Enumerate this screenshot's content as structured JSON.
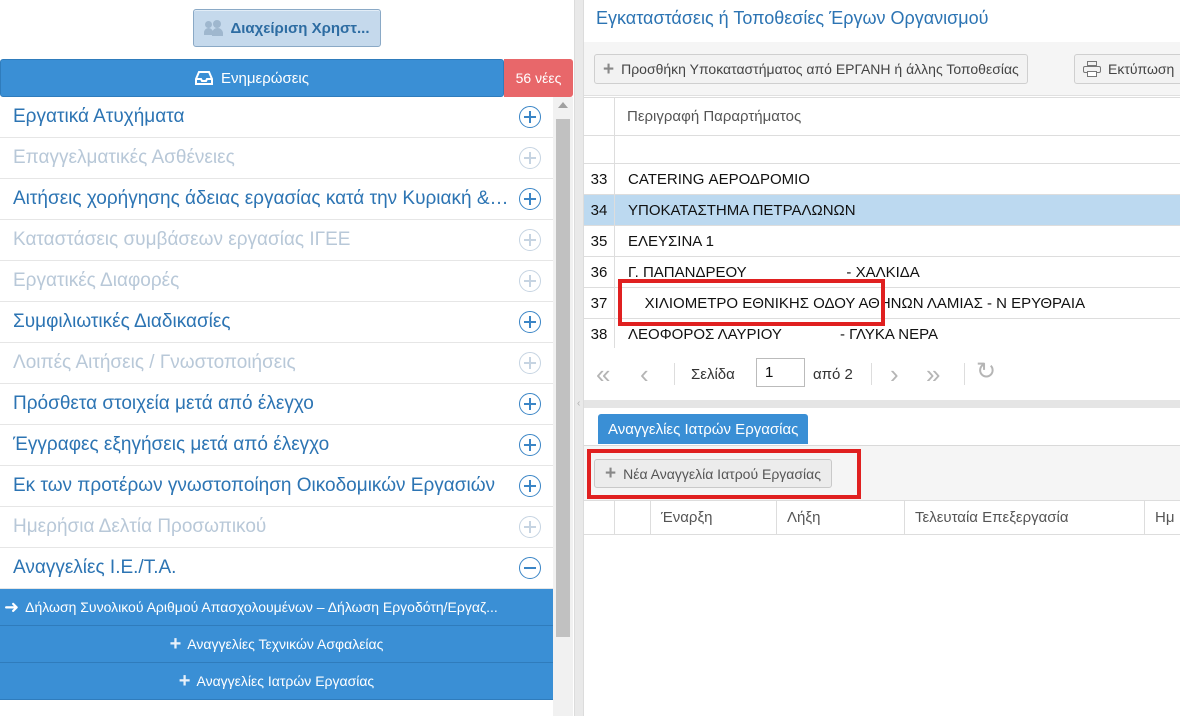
{
  "left": {
    "user_button": "Διαχείριση Χρηστ...",
    "updates_button": "Ενημερώσεις",
    "new_badge": "56 νέες",
    "menu": [
      {
        "label": "Εργατικά Ατυχήματα",
        "enabled": true,
        "state": "plus"
      },
      {
        "label": "Επαγγελματικές Ασθένειες",
        "enabled": false,
        "state": "plus"
      },
      {
        "label": "Αιτήσεις χορήγησης άδειας εργασίας κατά την Κυριακή & ...",
        "enabled": true,
        "state": "plus"
      },
      {
        "label": "Καταστάσεις συμβάσεων εργασίας ΙΓΕΕ",
        "enabled": false,
        "state": "plus"
      },
      {
        "label": "Εργατικές Διαφορές",
        "enabled": false,
        "state": "plus"
      },
      {
        "label": "Συμφιλιωτικές Διαδικασίες",
        "enabled": true,
        "state": "plus"
      },
      {
        "label": "Λοιπές Αιτήσεις / Γνωστοποιήσεις",
        "enabled": false,
        "state": "plus"
      },
      {
        "label": "Πρόσθετα στοιχεία μετά από έλεγχο",
        "enabled": true,
        "state": "plus"
      },
      {
        "label": "Έγγραφες εξηγήσεις μετά από έλεγχο",
        "enabled": true,
        "state": "plus"
      },
      {
        "label": "Εκ των προτέρων γνωστοποίηση Οικοδομικών Εργασιών",
        "enabled": true,
        "state": "plus"
      },
      {
        "label": "Ημερήσια Δελτία Προσωπικού",
        "enabled": false,
        "state": "plus"
      },
      {
        "label": "Αναγγελίες Ι.Ε./Τ.Α.",
        "enabled": true,
        "state": "minus"
      }
    ],
    "submenu": [
      "Δήλωση Συνολικού Αριθμού Απασχολουμένων – Δήλωση Εργοδότη/Εργαζ...",
      "Αναγγελίες Τεχνικών Ασφαλείας",
      "Αναγγελίες Ιατρών Εργασίας"
    ]
  },
  "right": {
    "title": "Εγκαταστάσεις ή Τοποθεσίες Έργων Οργανισμού",
    "add_branch_button": "Προσθήκη Υποκαταστήματος από ΕΡΓΑΝΗ ή άλλης Τοποθεσίας",
    "print_button": "Εκτύπωση",
    "grid_header": "Περιγραφή Παραρτήματος",
    "rows": [
      {
        "n": "33",
        "desc": "CATERING ΑΕΡΟΔΡΟΜΙΟ"
      },
      {
        "n": "34",
        "desc": "ΥΠΟΚΑΤΑΣΤΗΜΑ ΠΕΤΡΑΛΩΝΩΝ"
      },
      {
        "n": "35",
        "desc": "ΕΛΕΥΣΙΝΑ 1"
      },
      {
        "n": "36",
        "desc": "Γ. ΠΑΠΑΝΔΡΕΟΥ                        - ΧΑΛΚΙΔΑ"
      },
      {
        "n": "37",
        "desc": "    ΧΙΛΙΟΜΕΤΡΟ ΕΘΝΙΚΗΣ ΟΔΟΥ ΑΘΗΝΩΝ ΛΑΜΙΑΣ - Ν ΕΡΥΘΡΑΙΑ"
      },
      {
        "n": "38",
        "desc": "ΛΕΟΦΟΡΟΣ ΛΑΥΡΙΟΥ              - ΓΛΥΚΑ ΝΕΡΑ"
      }
    ],
    "pager": {
      "page_label": "Σελίδα",
      "page_value": "1",
      "of_label": "από 2"
    },
    "lower_tab": "Αναγγελίες Ιατρών Εργασίας",
    "new_notice_button": "Νέα Αναγγελία Ιατρού Εργασίας",
    "lower_columns": [
      "Έναρξη",
      "Λήξη",
      "Τελευταία Επεξεργασία",
      "Ημ"
    ]
  }
}
